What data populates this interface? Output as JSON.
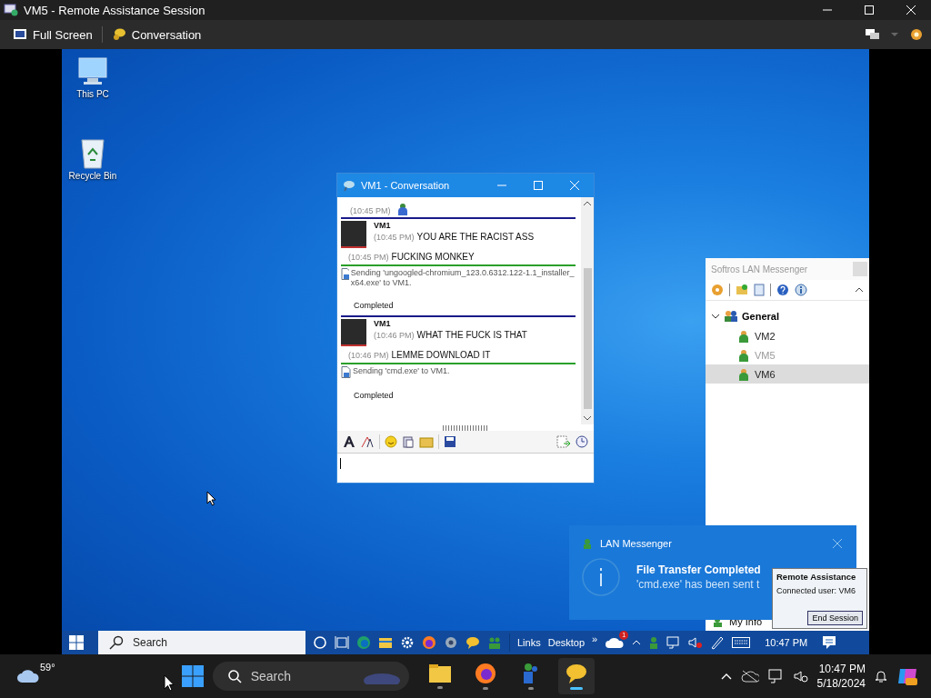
{
  "window": {
    "title": "VM5 - Remote Assistance Session"
  },
  "toolbar": [
    {
      "kind": "fullscreen",
      "label": "Full Screen"
    },
    {
      "kind": "conversation",
      "label": "Conversation"
    }
  ],
  "desktop_icons": [
    {
      "kind": "pc",
      "label": "This PC"
    },
    {
      "kind": "bin",
      "label": "Recycle Bin"
    }
  ],
  "conversation": {
    "title": "VM1 - Conversation",
    "entries": [
      {
        "kind": "partial",
        "time": "(10:45 PM)"
      },
      {
        "kind": "message",
        "sender": "VM1",
        "lines": [
          {
            "time": "(10:45 PM)",
            "text": "YOU ARE THE RACIST ASS"
          },
          {
            "time": "(10:45 PM)",
            "text": "FUCKING MONKEY"
          }
        ]
      },
      {
        "kind": "transfer",
        "text": "Sending 'ungoogled-chromium_123.0.6312.122-1.1_installer_x64.exe' to VM1.",
        "status": "Completed"
      },
      {
        "kind": "message",
        "sender": "VM1",
        "lines": [
          {
            "time": "(10:46 PM)",
            "text": "WHAT THE FUCK IS THAT"
          },
          {
            "time": "(10:46 PM)",
            "text": "LEMME DOWNLOAD IT"
          }
        ]
      },
      {
        "kind": "transfer",
        "text": "Sending 'cmd.exe' to VM1.",
        "status": "Completed"
      }
    ]
  },
  "messenger": {
    "title": "Softros LAN Messenger",
    "groups": [
      {
        "label": "General",
        "expanded": true,
        "children": [
          {
            "label": "VM2",
            "selected": false,
            "greyed": false
          },
          {
            "label": "VM5",
            "selected": false,
            "greyed": true
          },
          {
            "label": "VM6",
            "selected": true,
            "greyed": false
          }
        ]
      }
    ],
    "my_info": "My Info"
  },
  "toast": {
    "app": "LAN Messenger",
    "title": "File Transfer Completed",
    "body": "'cmd.exe' has been sent t"
  },
  "assistance_popup": {
    "title": "Remote Assistance",
    "text": "Connected user: VM6",
    "button": "End Session"
  },
  "remote_taskbar": {
    "search": "Search",
    "links": "Links",
    "desktop": "Desktop",
    "chevron": "»",
    "badge": "1",
    "time": "10:47 PM"
  },
  "host_taskbar": {
    "temperature": "59°",
    "search": "Search",
    "apps": [
      {
        "kind": "folder",
        "active": false
      },
      {
        "kind": "firefox",
        "active": false
      },
      {
        "kind": "messenger",
        "active": false
      },
      {
        "kind": "chat",
        "active": true
      }
    ],
    "time": "10:47 PM",
    "date": "5/18/2024"
  }
}
